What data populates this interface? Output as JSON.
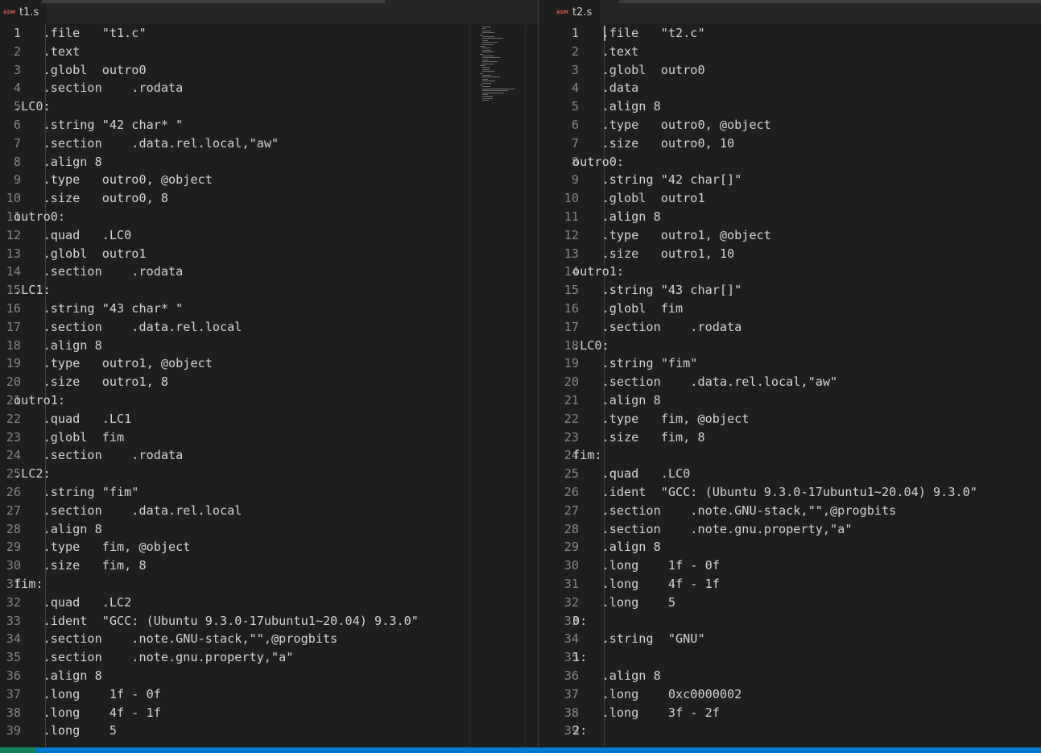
{
  "left": {
    "tab": {
      "icon": "ASM",
      "title": "t1.s"
    },
    "active_line": 1,
    "lines": [
      "    .file   \"t1.c\"",
      "    .text",
      "    .globl  outro0",
      "    .section    .rodata",
      ".LC0:",
      "    .string \"42 char* \"",
      "    .section    .data.rel.local,\"aw\"",
      "    .align 8",
      "    .type   outro0, @object",
      "    .size   outro0, 8",
      "outro0:",
      "    .quad   .LC0",
      "    .globl  outro1",
      "    .section    .rodata",
      ".LC1:",
      "    .string \"43 char* \"",
      "    .section    .data.rel.local",
      "    .align 8",
      "    .type   outro1, @object",
      "    .size   outro1, 8",
      "outro1:",
      "    .quad   .LC1",
      "    .globl  fim",
      "    .section    .rodata",
      ".LC2:",
      "    .string \"fim\"",
      "    .section    .data.rel.local",
      "    .align 8",
      "    .type   fim, @object",
      "    .size   fim, 8",
      "fim:",
      "    .quad   .LC2",
      "    .ident  \"GCC: (Ubuntu 9.3.0-17ubuntu1~20.04) 9.3.0\"",
      "    .section    .note.GNU-stack,\"\",@progbits",
      "    .section    .note.gnu.property,\"a\"",
      "    .align 8",
      "    .long    1f - 0f",
      "    .long    4f - 1f",
      "    .long    5"
    ]
  },
  "right": {
    "tab": {
      "icon": "ASM",
      "title": "t2.s"
    },
    "active_line": 1,
    "lines": [
      "    .file   \"t2.c\"",
      "    .text",
      "    .globl  outro0",
      "    .data",
      "    .align 8",
      "    .type   outro0, @object",
      "    .size   outro0, 10",
      "outro0:",
      "    .string \"42 char[]\"",
      "    .globl  outro1",
      "    .align 8",
      "    .type   outro1, @object",
      "    .size   outro1, 10",
      "outro1:",
      "    .string \"43 char[]\"",
      "    .globl  fim",
      "    .section    .rodata",
      ".LC0:",
      "    .string \"fim\"",
      "    .section    .data.rel.local,\"aw\"",
      "    .align 8",
      "    .type   fim, @object",
      "    .size   fim, 8",
      "fim:",
      "    .quad   .LC0",
      "    .ident  \"GCC: (Ubuntu 9.3.0-17ubuntu1~20.04) 9.3.0\"",
      "    .section    .note.GNU-stack,\"\",@progbits",
      "    .section    .note.gnu.property,\"a\"",
      "    .align 8",
      "    .long    1f - 0f",
      "    .long    4f - 1f",
      "    .long    5",
      "0:",
      "    .string  \"GNU\"",
      "1:",
      "    .align 8",
      "    .long    0xc0000002",
      "    .long    3f - 2f",
      "2:"
    ]
  },
  "colors": {
    "background": "#1e1e1e",
    "text": "#d4d4d4",
    "line_number": "#858585",
    "status_bar": "#007acc",
    "remote_indicator": "#16825d",
    "asm_icon": "#d7574a"
  }
}
